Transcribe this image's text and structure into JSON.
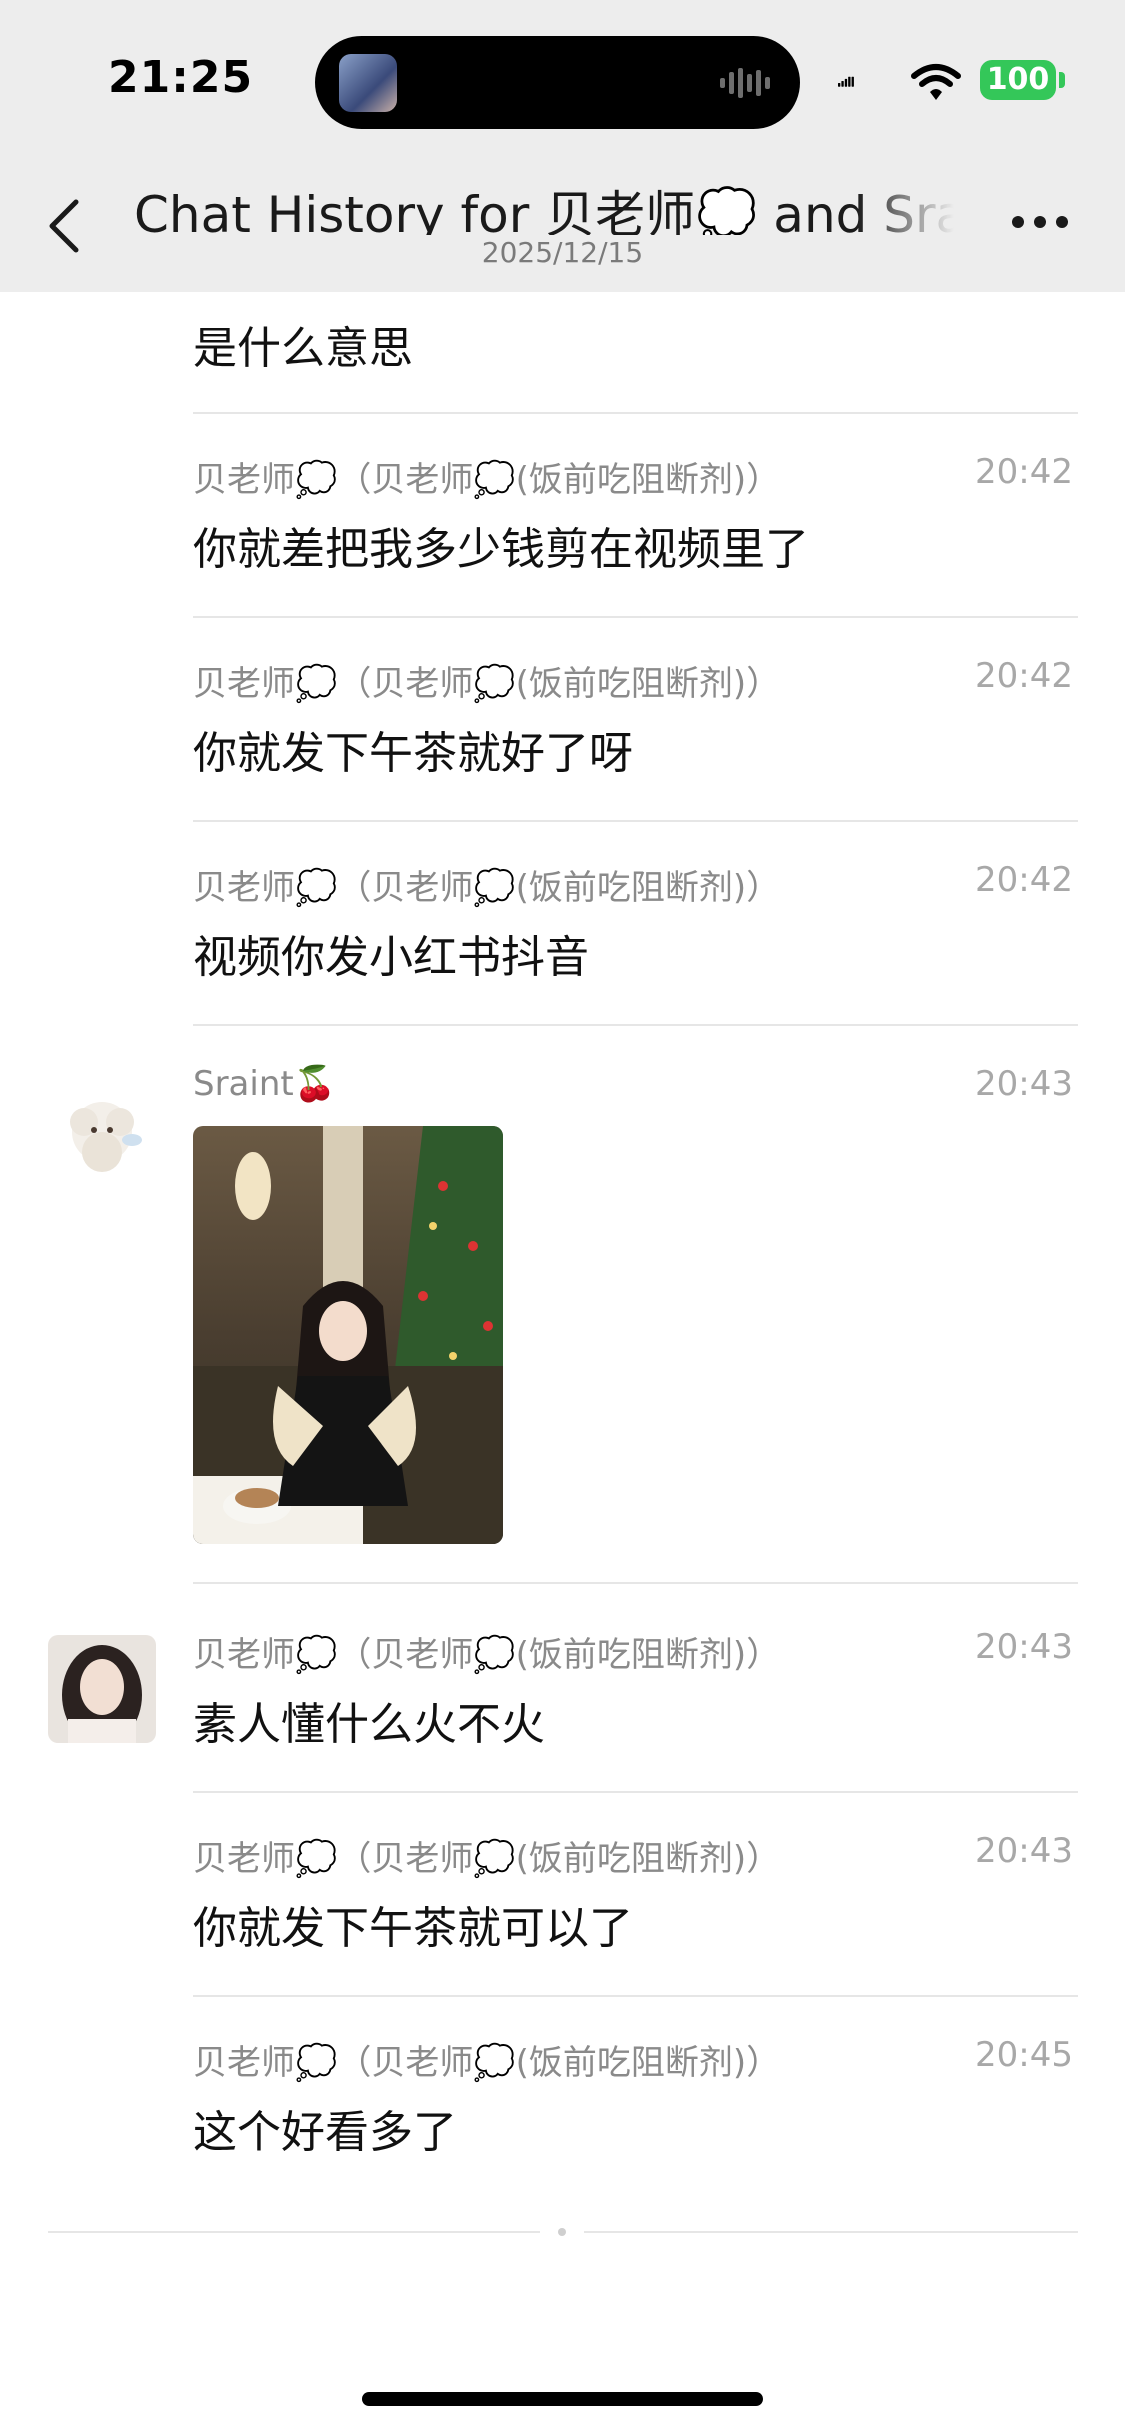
{
  "status_bar": {
    "time": "21:25",
    "battery": "100"
  },
  "nav": {
    "title": "Chat History for 贝老师💭 and Srain",
    "date": "2025/12/15"
  },
  "top_partial_message": "是什么意思",
  "messages": [
    {
      "sender": "贝老师💭（贝老师💭(饭前吃阻断剂)）",
      "time": "20:42",
      "text": "你就差把我多少钱剪在视频里了"
    },
    {
      "sender": "贝老师💭（贝老师💭(饭前吃阻断剂)）",
      "time": "20:42",
      "text": "你就发下午茶就好了呀"
    },
    {
      "sender": "贝老师💭（贝老师💭(饭前吃阻断剂)）",
      "time": "20:42",
      "text": "视频你发小红书抖音"
    },
    {
      "sender": "Sraint🍒",
      "time": "20:43",
      "text": ""
    },
    {
      "sender": "贝老师💭（贝老师💭(饭前吃阻断剂)）",
      "time": "20:43",
      "text": "素人懂什么火不火"
    },
    {
      "sender": "贝老师💭（贝老师💭(饭前吃阻断剂)）",
      "time": "20:43",
      "text": "你就发下午茶就可以了"
    },
    {
      "sender": "贝老师💭（贝老师💭(饭前吃阻断剂)）",
      "time": "20:45",
      "text": "这个好看多了"
    }
  ],
  "icons": {
    "back": "chevron-left-icon",
    "more": "more-dots-icon",
    "signal": "signal-icon",
    "wifi": "wifi-icon",
    "battery": "battery-icon"
  },
  "colors": {
    "header_bg": "#ededed",
    "battery": "#34c759",
    "divider": "#e6e6e6",
    "meta_text": "#8a8a8a"
  }
}
